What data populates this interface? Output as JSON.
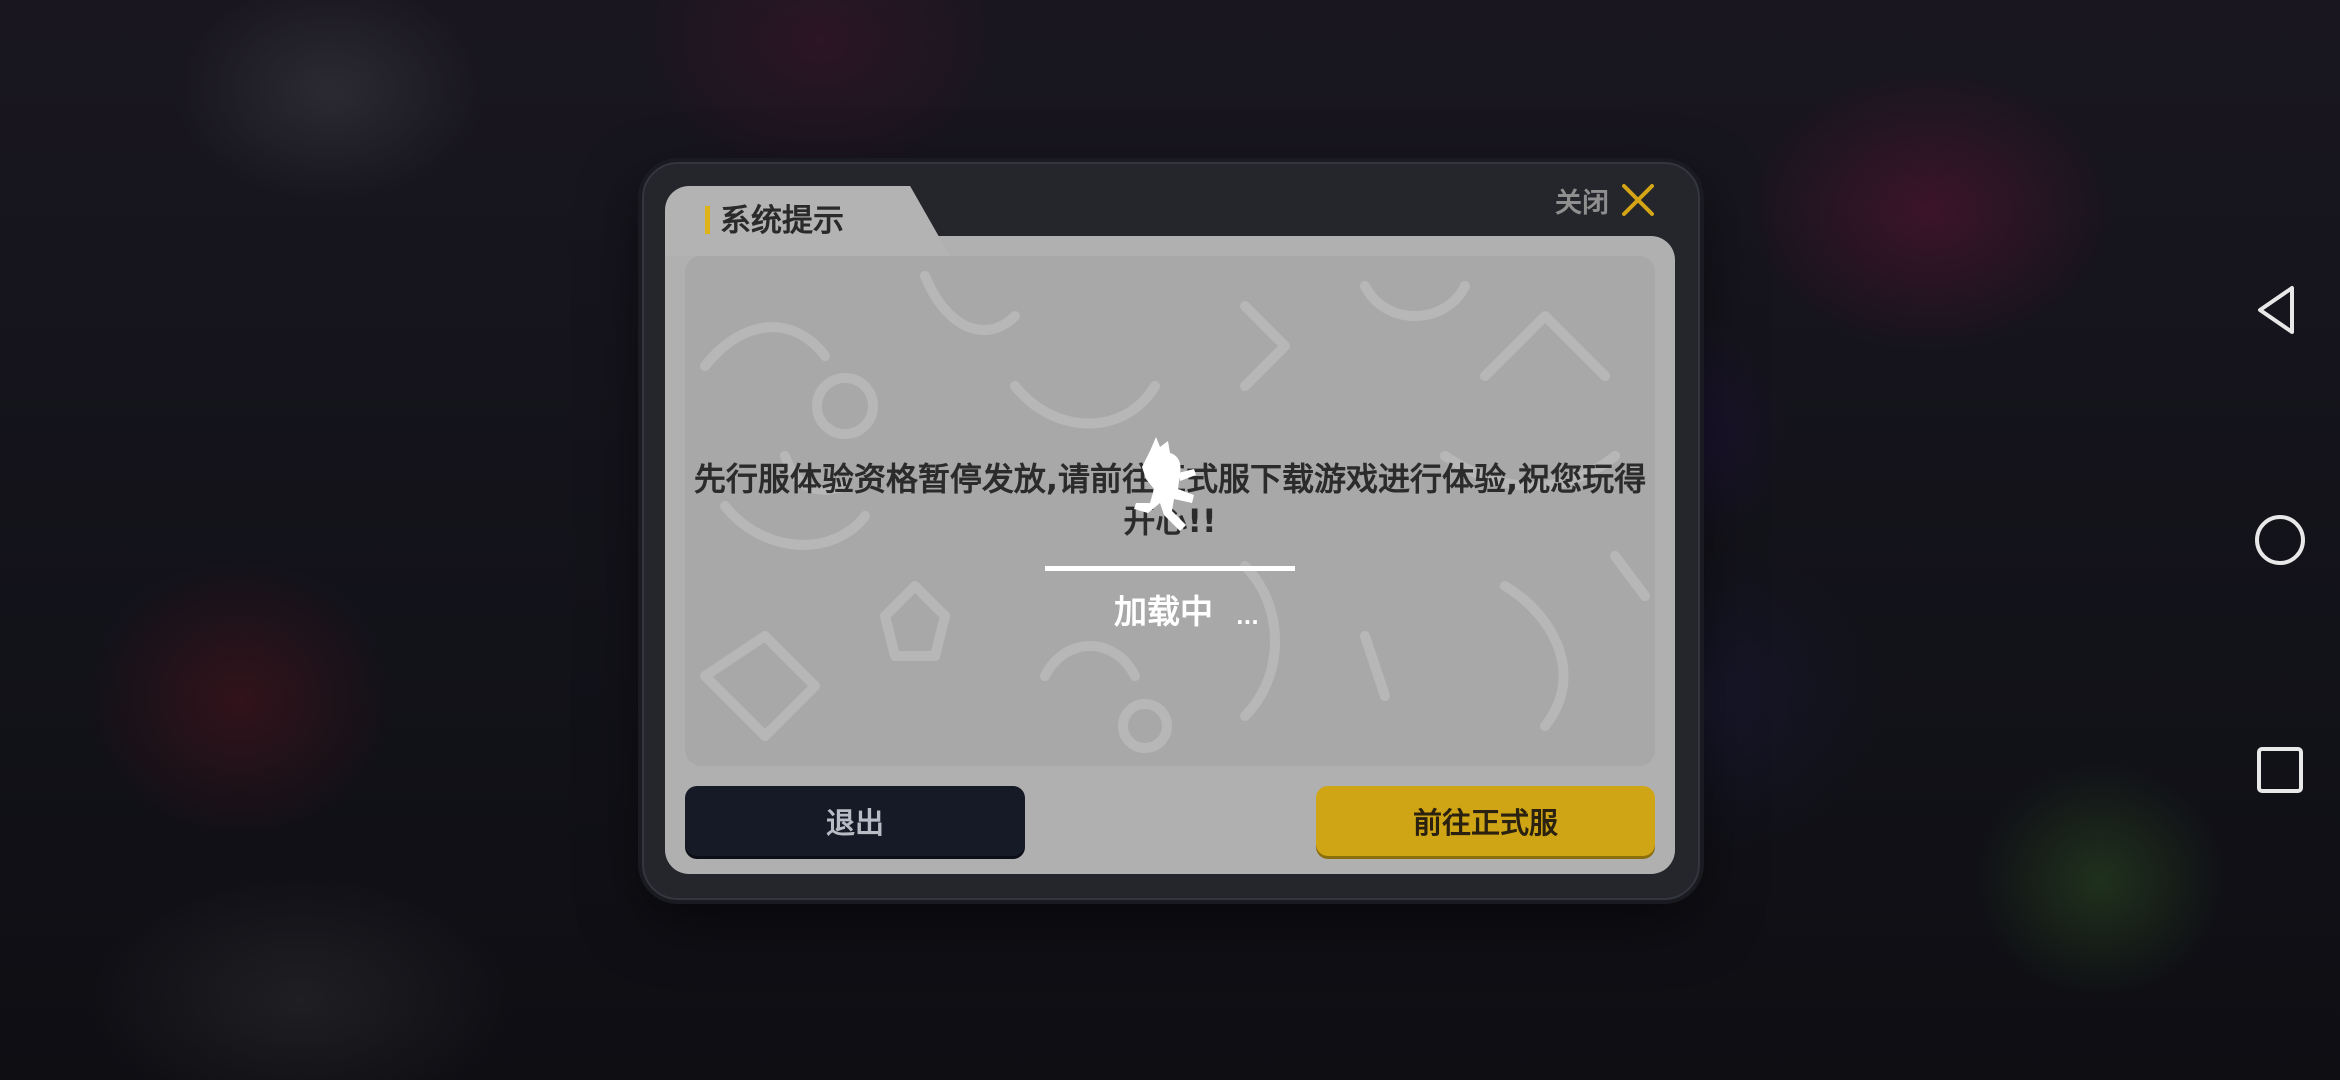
{
  "dialog": {
    "title": "系统提示",
    "close_label": "关闭",
    "message": "先行服体验资格暂停发放,请前往正式服下载游戏进行体验,祝您玩得开心!!",
    "buttons": {
      "exit_label": "退出",
      "go_label": "前往正式服"
    }
  },
  "loading": {
    "text": "加载中",
    "dots": "..."
  },
  "nav": {
    "icons": [
      "back-icon",
      "home-icon",
      "recents-icon"
    ]
  },
  "colors": {
    "accent": "#cfa515",
    "exit_button": "#161a27",
    "close_icon": "#d4a514"
  }
}
